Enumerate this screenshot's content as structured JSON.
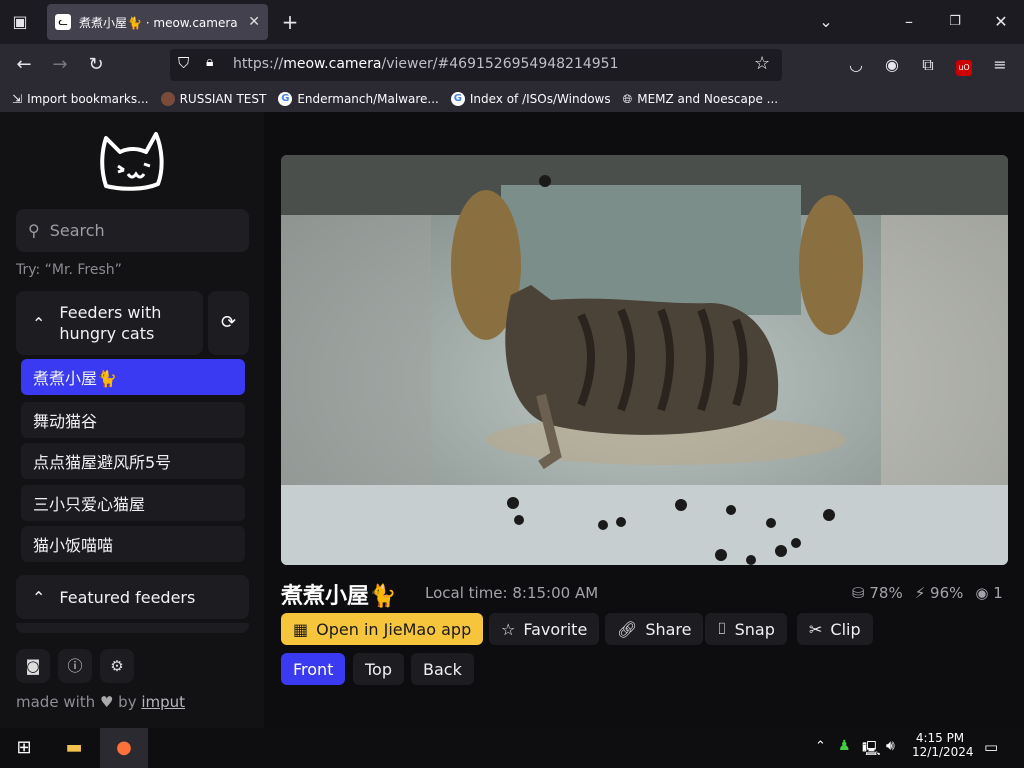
{
  "browser": {
    "tab_title": "煮煮小屋🐈 · meow.camera",
    "url_prefix": "https://",
    "url_host": "meow.camera",
    "url_path": "/viewer/#4691526954948214951",
    "bookmarks": [
      "Import bookmarks...",
      "RUSSIAN TEST",
      "Endermanch/Malware...",
      "Index of /ISOs/Windows",
      "MEMZ and Noescape ..."
    ]
  },
  "sidebar": {
    "search_placeholder": "Search",
    "try_hint": "Try: “Mr. Fresh”",
    "group1_title": "Feeders with hungry cats",
    "feeders": [
      "煮煮小屋🐈",
      "舞动猫谷",
      "点点猫屋避风所5号",
      "三小只爱心猫屋",
      "猫小饭喵喵"
    ],
    "group2_title": "Featured feeders",
    "made_with": "made with",
    "by": "by",
    "author": "imput"
  },
  "viewer": {
    "title": "煮煮小屋🐈",
    "local_time": "Local time: 8:15:00 AM",
    "food_level": "78%",
    "battery_level": "96%",
    "viewers": "1",
    "buttons": {
      "open_app": "Open in JieMao app",
      "favorite": "Favorite",
      "share": "Share",
      "snap": "Snap",
      "clip": "Clip"
    },
    "views": [
      "Front",
      "Top",
      "Back"
    ]
  },
  "taskbar": {
    "time": "4:15 PM",
    "date": "12/1/2024"
  },
  "colors": {
    "accent_blue": "#3a3af2",
    "accent_yellow": "#f7c53b"
  }
}
